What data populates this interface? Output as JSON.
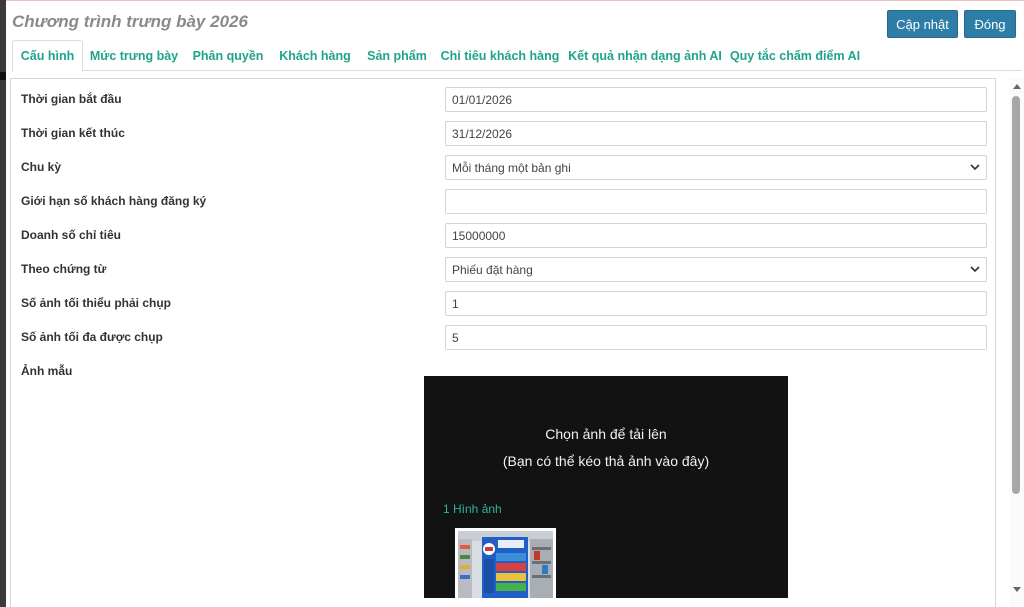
{
  "window": {
    "title": "Chương trình trưng bày 2026"
  },
  "toolbar": {
    "update_label": "Cập nhật",
    "close_label": "Đóng"
  },
  "tabs": [
    {
      "label": "Cấu hình",
      "active": true
    },
    {
      "label": "Mức trưng bày"
    },
    {
      "label": "Phân quyền"
    },
    {
      "label": "Khách hàng"
    },
    {
      "label": "Sản phẩm"
    },
    {
      "label": "Chỉ tiêu khách hàng"
    },
    {
      "label": "Kết quả nhận dạng ảnh AI"
    },
    {
      "label": "Quy tắc chấm điểm AI"
    }
  ],
  "form": {
    "start_date": {
      "label": "Thời gian bắt đầu",
      "value": "01/01/2026"
    },
    "end_date": {
      "label": "Thời gian kết thúc",
      "value": "31/12/2026"
    },
    "cycle": {
      "label": "Chu kỳ",
      "value": "Mỗi tháng một bản ghi"
    },
    "customer_limit": {
      "label": "Giới hạn số khách hàng đăng ký",
      "value": ""
    },
    "target_sales": {
      "label": "Doanh số chỉ tiêu",
      "value": "15000000"
    },
    "by_document": {
      "label": "Theo chứng từ",
      "value": "Phiếu đặt hàng"
    },
    "min_photos": {
      "label": "Số ảnh tối thiểu phải chụp",
      "value": "1"
    },
    "max_photos": {
      "label": "Số ảnh tối đa được chụp",
      "value": "5"
    },
    "sample_image": {
      "label": "Ảnh mẫu"
    }
  },
  "upload": {
    "title": "Chọn ảnh để tải lên",
    "subtitle": "(Bạn có thể kéo thả ảnh vào đây)",
    "count_text": "1 Hình ảnh"
  },
  "colors": {
    "accent_tab": "#21a38b",
    "button": "#2e7da6",
    "upload_bg": "#121212"
  }
}
